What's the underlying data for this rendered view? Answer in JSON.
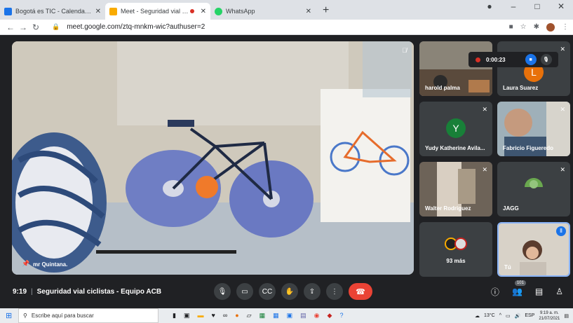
{
  "browser": {
    "tabs": [
      {
        "title": "Bogotá es TIC - Calendar - miérc",
        "active": false
      },
      {
        "title": "Meet - Seguridad vial ciclista",
        "active": true
      },
      {
        "title": "WhatsApp",
        "active": false
      }
    ],
    "url": "meet.google.com/ztq-mnkm-wic?authuser=2"
  },
  "meeting": {
    "time": "9:19",
    "title": "Seguridad vial ciclistas - Equipo ACB",
    "recording_time": "0:00:23",
    "participants_count": "101",
    "main_speaker": "mr Quintana."
  },
  "tiles": [
    {
      "name": "harold palma",
      "muted": false
    },
    {
      "name": "Laura Suarez",
      "muted": true,
      "initial": "L",
      "color": "#e8710a"
    },
    {
      "name": "Yudy Katherine Avila...",
      "muted": true,
      "initial": "Y",
      "color": "#188038"
    },
    {
      "name": "Fabricio Figueredo",
      "muted": true
    },
    {
      "name": "Walter Rodriguez",
      "muted": true
    },
    {
      "name": "JAGG",
      "muted": true
    },
    {
      "name": "93 más",
      "muted": false
    },
    {
      "name": "Tú",
      "muted": false
    }
  ],
  "taskbar": {
    "search_placeholder": "Escribe aquí para buscar",
    "temperature": "13°C",
    "lang": "ESP",
    "clock_time": "9:19 a. m.",
    "clock_date": "21/07/2021"
  },
  "colors": {
    "accent": "#1a73e8",
    "end_call": "#ea4335",
    "record": "#d93025"
  }
}
